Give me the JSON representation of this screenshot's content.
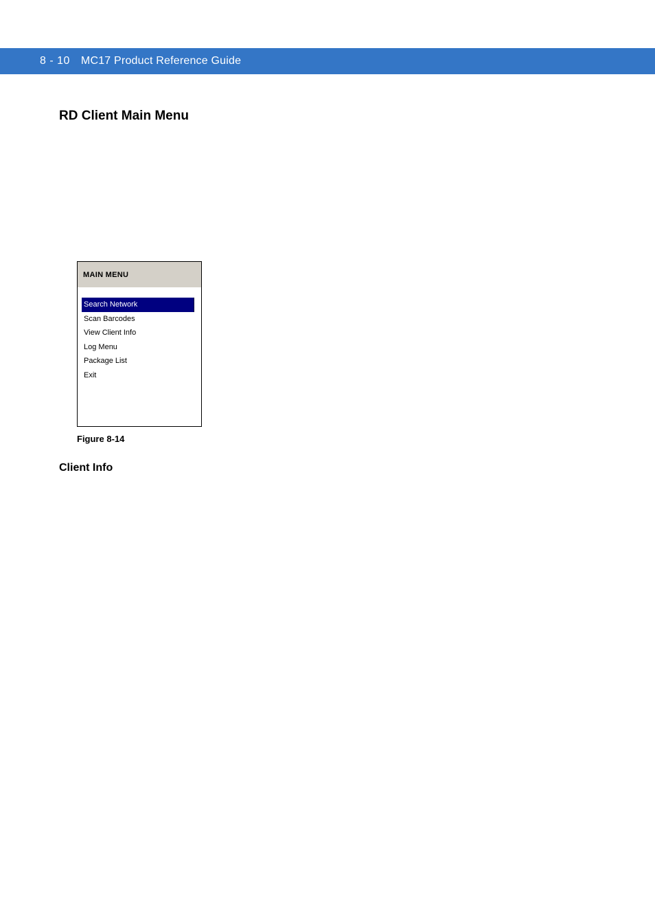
{
  "header": {
    "page_number": "8 - 10",
    "doc_title": "MC17 Product Reference Guide"
  },
  "section": {
    "heading": "RD Client Main Menu"
  },
  "device_window": {
    "title": "MAIN MENU",
    "menu_items": [
      {
        "label": "Search Network",
        "selected": true
      },
      {
        "label": "Scan Barcodes",
        "selected": false
      },
      {
        "label": "View Client Info",
        "selected": false
      },
      {
        "label": "Log Menu",
        "selected": false
      },
      {
        "label": "Package List",
        "selected": false
      },
      {
        "label": "Exit",
        "selected": false
      }
    ]
  },
  "figure_caption": "Figure 8-14",
  "subsection": {
    "heading": "Client Info"
  }
}
